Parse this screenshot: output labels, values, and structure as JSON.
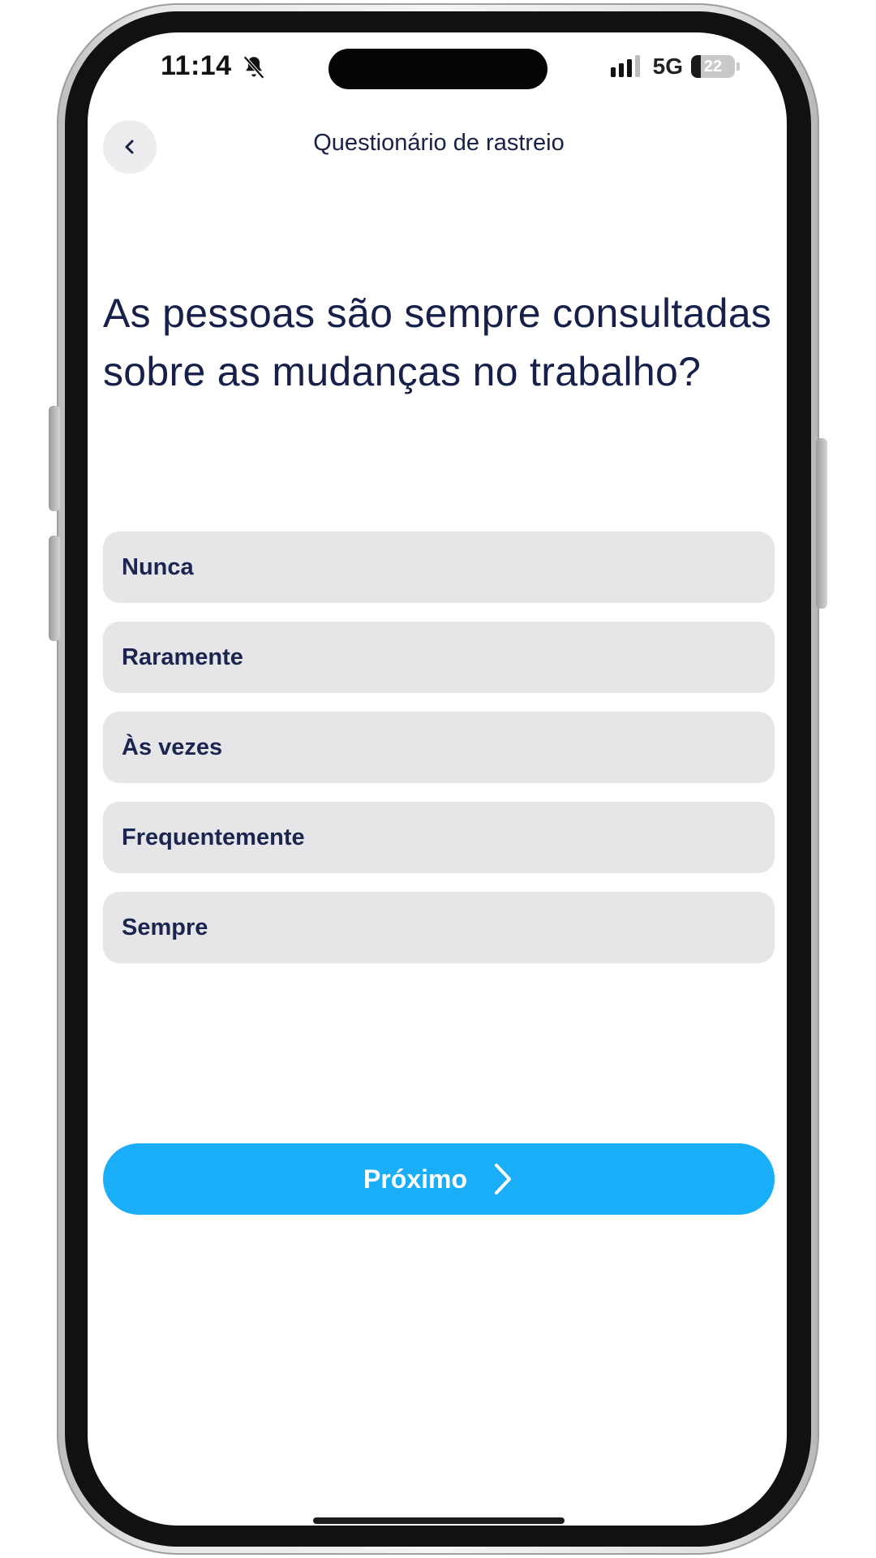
{
  "status_bar": {
    "time": "11:14",
    "network": "5G",
    "battery_level": "22",
    "battery_fraction": 0.22,
    "icons": [
      "bell-slash-icon",
      "signal-icon",
      "battery-icon"
    ]
  },
  "header": {
    "back_icon": "chevron-left-icon",
    "title": "Questionário de rastreio"
  },
  "question": {
    "text": "As pessoas são sempre consultadas sobre as mudanças no trabalho?"
  },
  "options": [
    {
      "label": "Nunca"
    },
    {
      "label": "Raramente"
    },
    {
      "label": "Às vezes"
    },
    {
      "label": "Frequentemente"
    },
    {
      "label": "Sempre"
    }
  ],
  "next_button": {
    "label": "Próximo",
    "icon": "chevron-right-icon"
  },
  "colors": {
    "primary": "#1aaef8",
    "text_dark": "#16204a",
    "option_bg": "#e6e6e8"
  }
}
